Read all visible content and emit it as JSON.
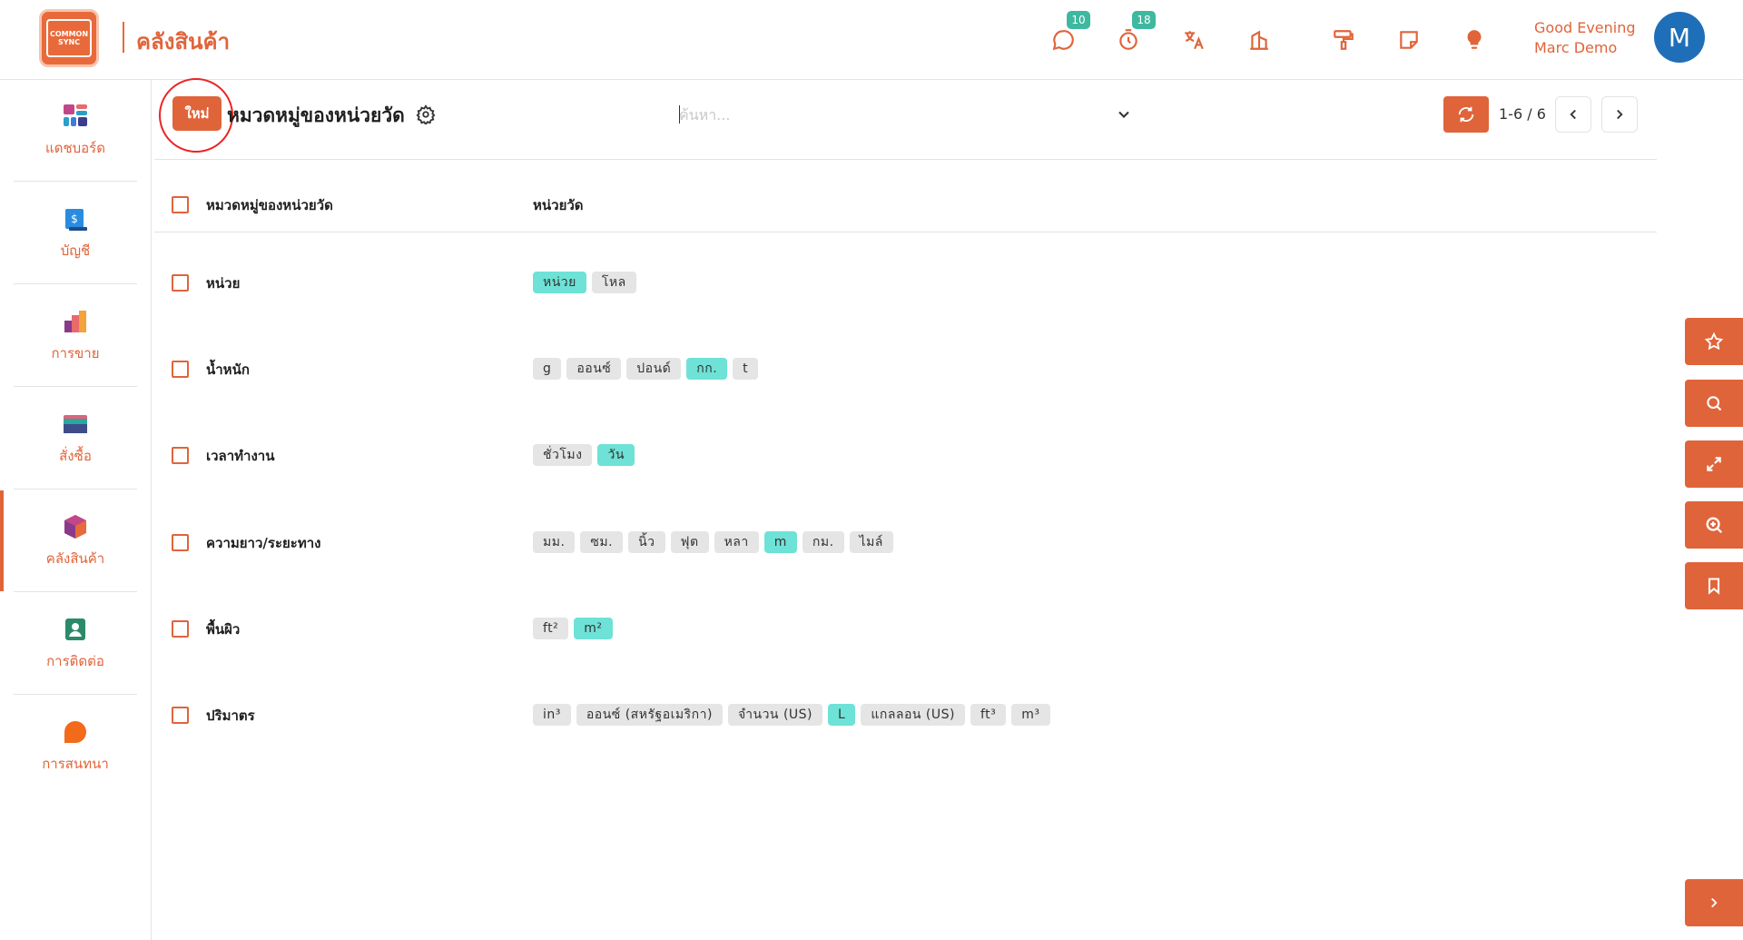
{
  "header": {
    "logo_text_1": "COMMON",
    "logo_text_2": "SYNC",
    "brand_title": "คลังสินค้า",
    "chat_badge": "10",
    "timer_badge": "18",
    "greeting_line1": "Good Evening",
    "greeting_line2": "Marc Demo",
    "avatar_letter": "M"
  },
  "sidebar": {
    "items": [
      {
        "label": "แดชบอร์ด",
        "icon": "dashboard-icon"
      },
      {
        "label": "บัญชี",
        "icon": "accounting-icon"
      },
      {
        "label": "การขาย",
        "icon": "sales-icon"
      },
      {
        "label": "สั่งซื้อ",
        "icon": "purchase-icon"
      },
      {
        "label": "คลังสินค้า",
        "icon": "inventory-icon"
      },
      {
        "label": "การติดต่อ",
        "icon": "contacts-icon"
      },
      {
        "label": "การสนทนา",
        "icon": "discuss-icon"
      }
    ]
  },
  "control": {
    "new_label": "ใหม่",
    "title": "หมวดหมู่ของหน่วยวัด",
    "search_placeholder": "ค้นหา...",
    "pager": "1-6 / 6"
  },
  "table": {
    "headers": [
      "หมวดหมู่ของหน่วยวัด",
      "หน่วยวัด"
    ],
    "rows": [
      {
        "name": "หน่วย",
        "tags": [
          {
            "t": "หน่วย",
            "hl": true
          },
          {
            "t": "โหล",
            "hl": false
          }
        ]
      },
      {
        "name": "น้ำหนัก",
        "tags": [
          {
            "t": "g",
            "hl": false
          },
          {
            "t": "ออนซ์",
            "hl": false
          },
          {
            "t": "ปอนด์",
            "hl": false
          },
          {
            "t": "กก.",
            "hl": true
          },
          {
            "t": "t",
            "hl": false
          }
        ]
      },
      {
        "name": "เวลาทำงาน",
        "tags": [
          {
            "t": "ชั่วโมง",
            "hl": false
          },
          {
            "t": "วัน",
            "hl": true
          }
        ]
      },
      {
        "name": "ความยาว/ระยะทาง",
        "tags": [
          {
            "t": "มม.",
            "hl": false
          },
          {
            "t": "ซม.",
            "hl": false
          },
          {
            "t": "นิ้ว",
            "hl": false
          },
          {
            "t": "ฟุต",
            "hl": false
          },
          {
            "t": "หลา",
            "hl": false
          },
          {
            "t": "m",
            "hl": true
          },
          {
            "t": "กม.",
            "hl": false
          },
          {
            "t": "ไมล์",
            "hl": false
          }
        ]
      },
      {
        "name": "พื้นผิว",
        "tags": [
          {
            "t": "ft²",
            "hl": false
          },
          {
            "t": "m²",
            "hl": true
          }
        ]
      },
      {
        "name": "ปริมาตร",
        "tags": [
          {
            "t": "in³",
            "hl": false
          },
          {
            "t": "ออนซ์ (สหรัฐอเมริกา)",
            "hl": false
          },
          {
            "t": "จำนวน (US)",
            "hl": false
          },
          {
            "t": "L",
            "hl": true
          },
          {
            "t": "แกลลอน (US)",
            "hl": false
          },
          {
            "t": "ft³",
            "hl": false
          },
          {
            "t": "m³",
            "hl": false
          }
        ]
      }
    ]
  },
  "colors": {
    "accent": "#e0643a",
    "tag_highlight": "#6ee2d6",
    "tag_default": "#e5e5e5",
    "badge": "#3fb8a0",
    "avatar": "#1e6fb8"
  }
}
